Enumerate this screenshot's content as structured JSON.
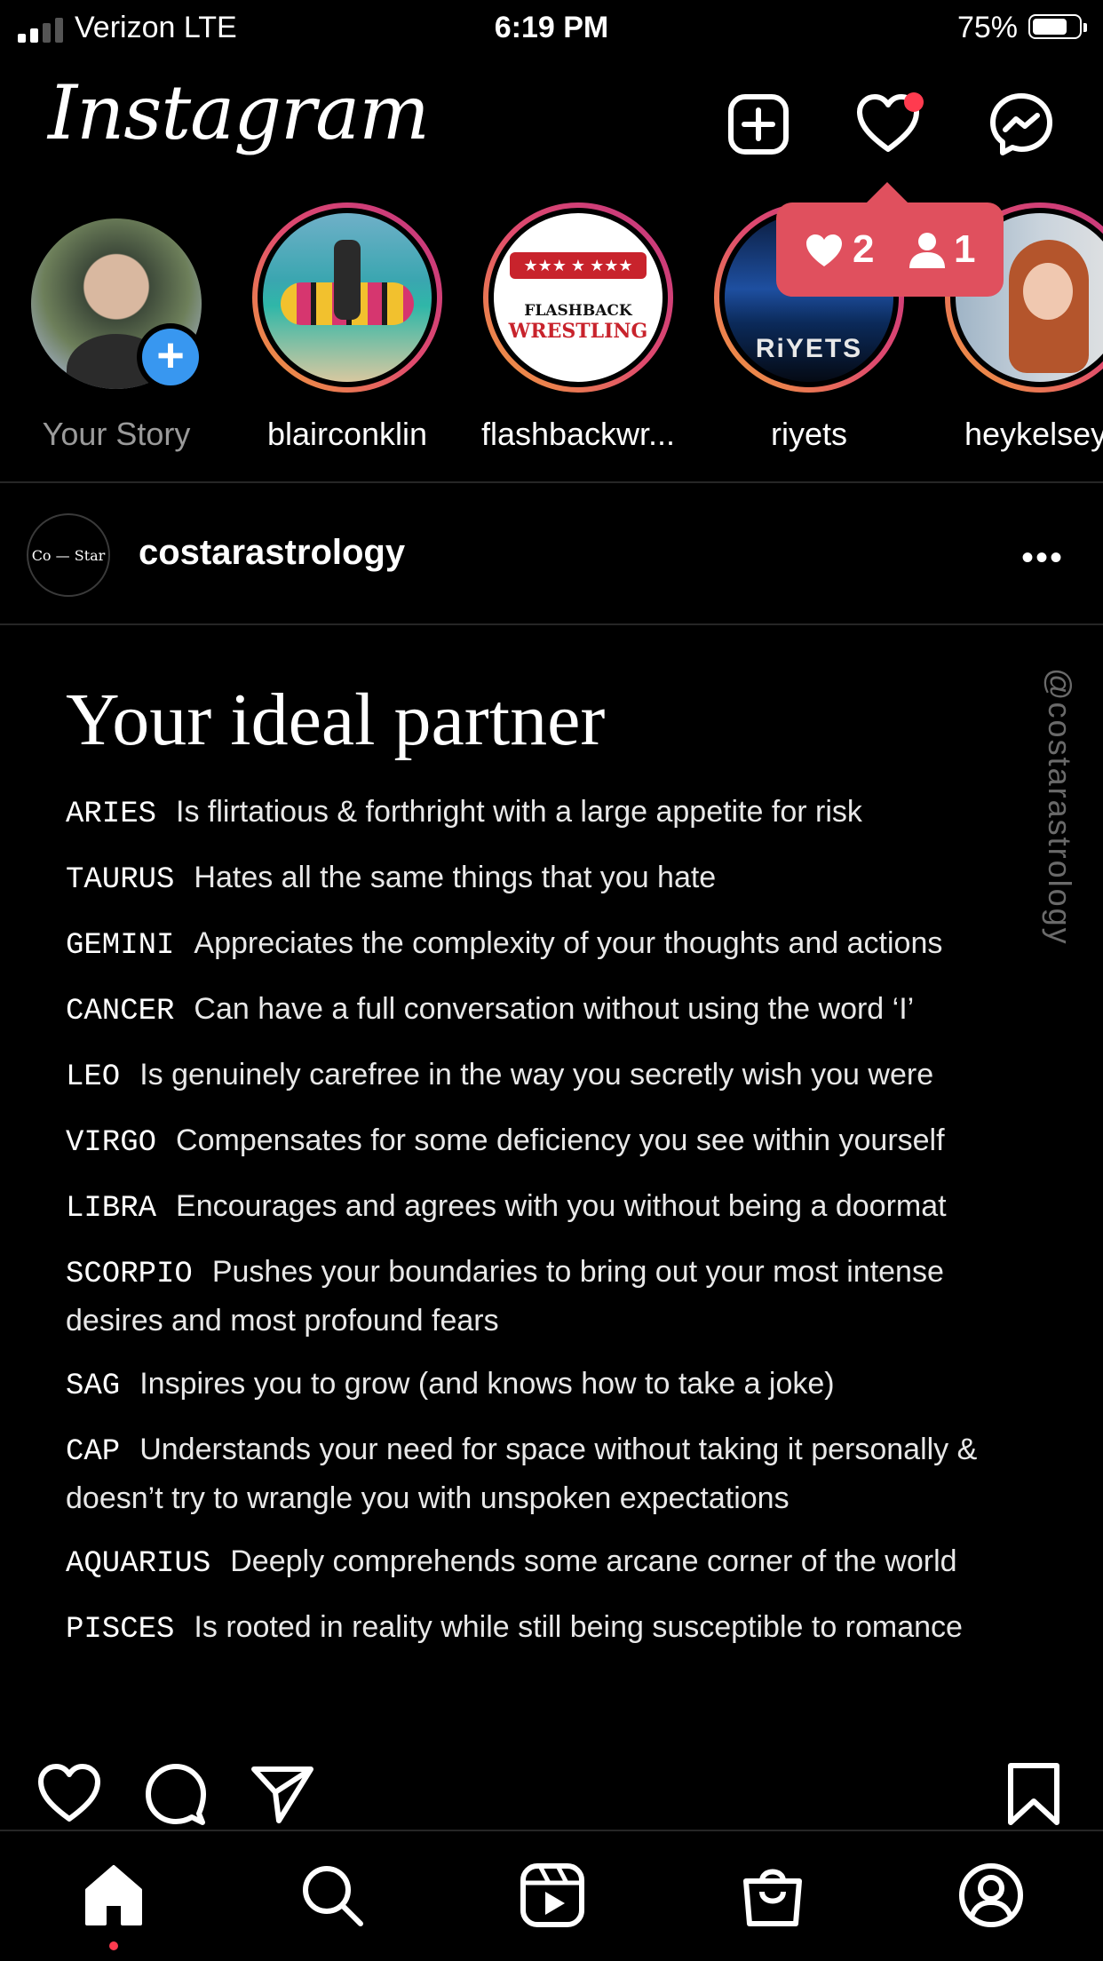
{
  "status_bar": {
    "carrier": "Verizon  LTE",
    "time": "6:19 PM",
    "battery_percent": "75%",
    "battery_level": 0.75,
    "signal_bars": 2
  },
  "header": {
    "logo": "Instagram",
    "icons": [
      "new-post-icon",
      "heart-icon",
      "messenger-icon"
    ]
  },
  "activity_popup": {
    "likes": "2",
    "follows": "1",
    "color": "#e0505e"
  },
  "stories": [
    {
      "name": "Your Story",
      "is_own": true
    },
    {
      "name": "blairconklin"
    },
    {
      "name": "flashbackwr..."
    },
    {
      "name": "riyets",
      "overlay_text": "RiYETS"
    },
    {
      "name": "heykelsey"
    }
  ],
  "flashback_logo": {
    "line1": "FLASHBACK",
    "line2": "WRESTLING"
  },
  "post": {
    "avatar_text": "Co — Star",
    "username": "costarastrology",
    "more": "•••",
    "title": "Your ideal partner",
    "watermark": "@costarastrology",
    "entries": [
      {
        "sign": "ARIES",
        "text": "Is flirtatious & forthright with a large appetite for risk"
      },
      {
        "sign": "TAURUS",
        "text": "Hates all the same things that you hate"
      },
      {
        "sign": "GEMINI",
        "text": "Appreciates the complexity of your thoughts and actions"
      },
      {
        "sign": "CANCER",
        "text": "Can have a full conversation without using the word ‘I’"
      },
      {
        "sign": "LEO",
        "text": "Is genuinely carefree in the way you secretly wish you were"
      },
      {
        "sign": "VIRGO",
        "text": "Compensates for some deficiency you see within yourself"
      },
      {
        "sign": "LIBRA",
        "text": "Encourages and agrees with you without being a doormat"
      },
      {
        "sign": "SCORPIO",
        "text": "Pushes your boundaries to bring out your most intense desires and most profound fears"
      },
      {
        "sign": "SAG",
        "text": "Inspires you to grow (and knows how to take a joke)"
      },
      {
        "sign": "CAP",
        "text": "Understands your need for space without taking it personally & doesn’t try to wrangle you with unspoken expectations"
      },
      {
        "sign": "AQUARIUS",
        "text": "Deeply comprehends some arcane corner of the world"
      },
      {
        "sign": "PISCES",
        "text": "Is rooted in reality while still being susceptible to romance"
      }
    ]
  },
  "actions": [
    "like-icon",
    "comment-icon",
    "share-icon",
    "save-icon"
  ],
  "tab_bar": [
    "home-icon",
    "search-icon",
    "reels-icon",
    "shop-icon",
    "profile-icon"
  ],
  "colors": {
    "background": "#000000",
    "story_ring": "#e04a6e",
    "add_story": "#3897f0",
    "notification_dot": "#ff3b4f"
  }
}
